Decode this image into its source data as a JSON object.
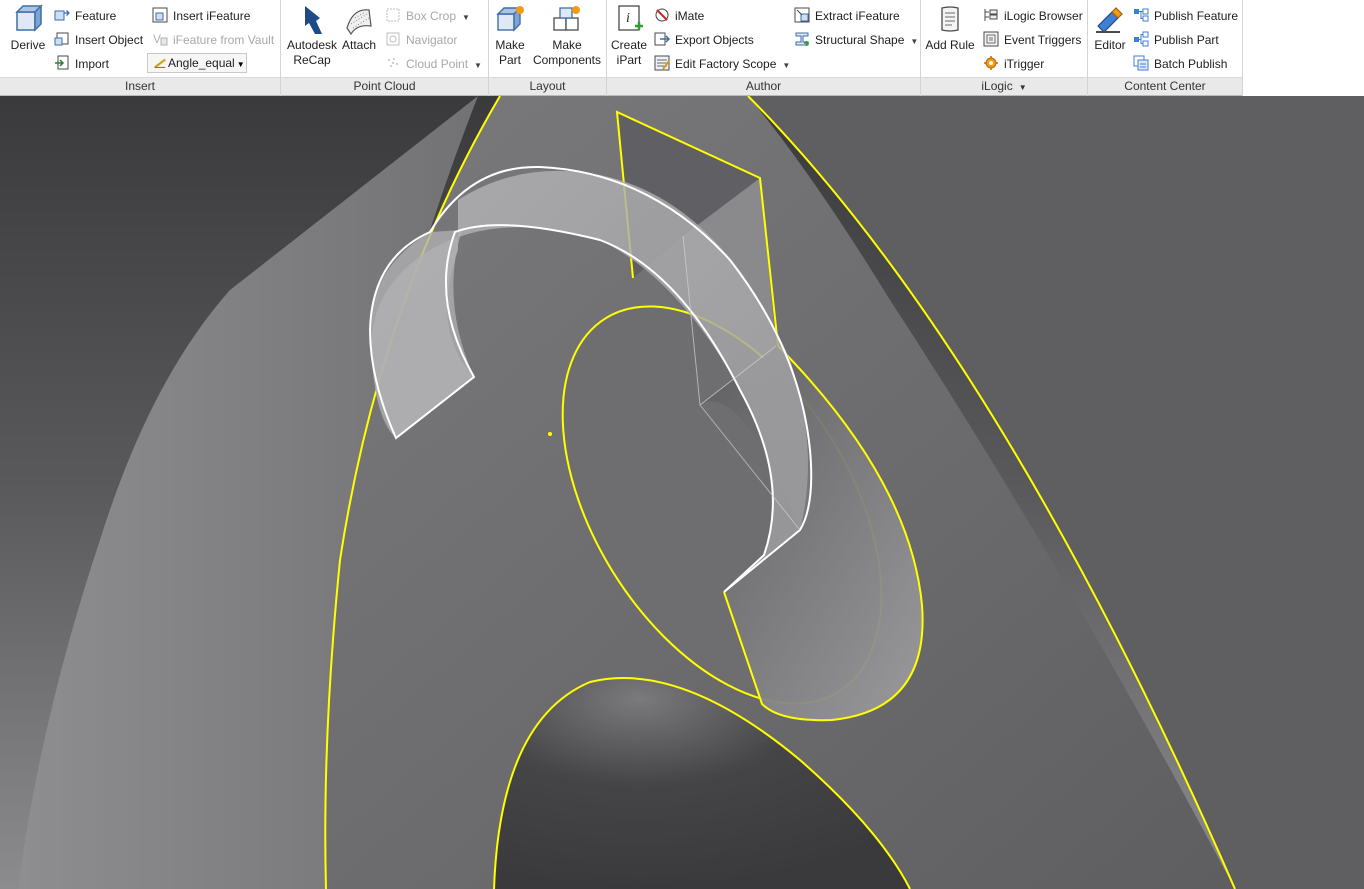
{
  "ribbon": {
    "insert": {
      "label": "Insert",
      "derive": "Derive",
      "feature": "Feature",
      "insert_object": "Insert Object",
      "import": "Import",
      "insert_ifeature": "Insert iFeature",
      "ifeature_from_vault": "iFeature from Vault",
      "angle_combo": "Angle_equal"
    },
    "point_cloud": {
      "label": "Point Cloud",
      "recap_line1": "Autodesk",
      "recap_line2": "ReCap",
      "attach": "Attach",
      "box_crop": "Box Crop",
      "navigator": "Navigator",
      "cloud_point": "Cloud Point"
    },
    "layout": {
      "label": "Layout",
      "make_part_line1": "Make",
      "make_part_line2": "Part",
      "make_components_line1": "Make",
      "make_components_line2": "Components"
    },
    "author": {
      "label": "Author",
      "create_ipart_line1": "Create",
      "create_ipart_line2": "iPart",
      "imate": "iMate",
      "export_objects": "Export Objects",
      "edit_factory_scope": "Edit Factory Scope",
      "extract_ifeature": "Extract iFeature",
      "structural_shape": "Structural Shape"
    },
    "ilogic": {
      "label": "iLogic",
      "add_rule": "Add Rule",
      "ilogic_browser": "iLogic Browser",
      "event_triggers": "Event Triggers",
      "itrigger": "iTrigger"
    },
    "content_center": {
      "label": "Content Center",
      "editor": "Editor",
      "publish_feature": "Publish Feature",
      "publish_part": "Publish Part",
      "batch_publish": "Batch Publish"
    }
  },
  "colors": {
    "edge_highlight": "#ffff00",
    "selection_edge": "#ffffff",
    "background_dark": "#3c3c3e",
    "background_light": "#8a8a8c"
  }
}
